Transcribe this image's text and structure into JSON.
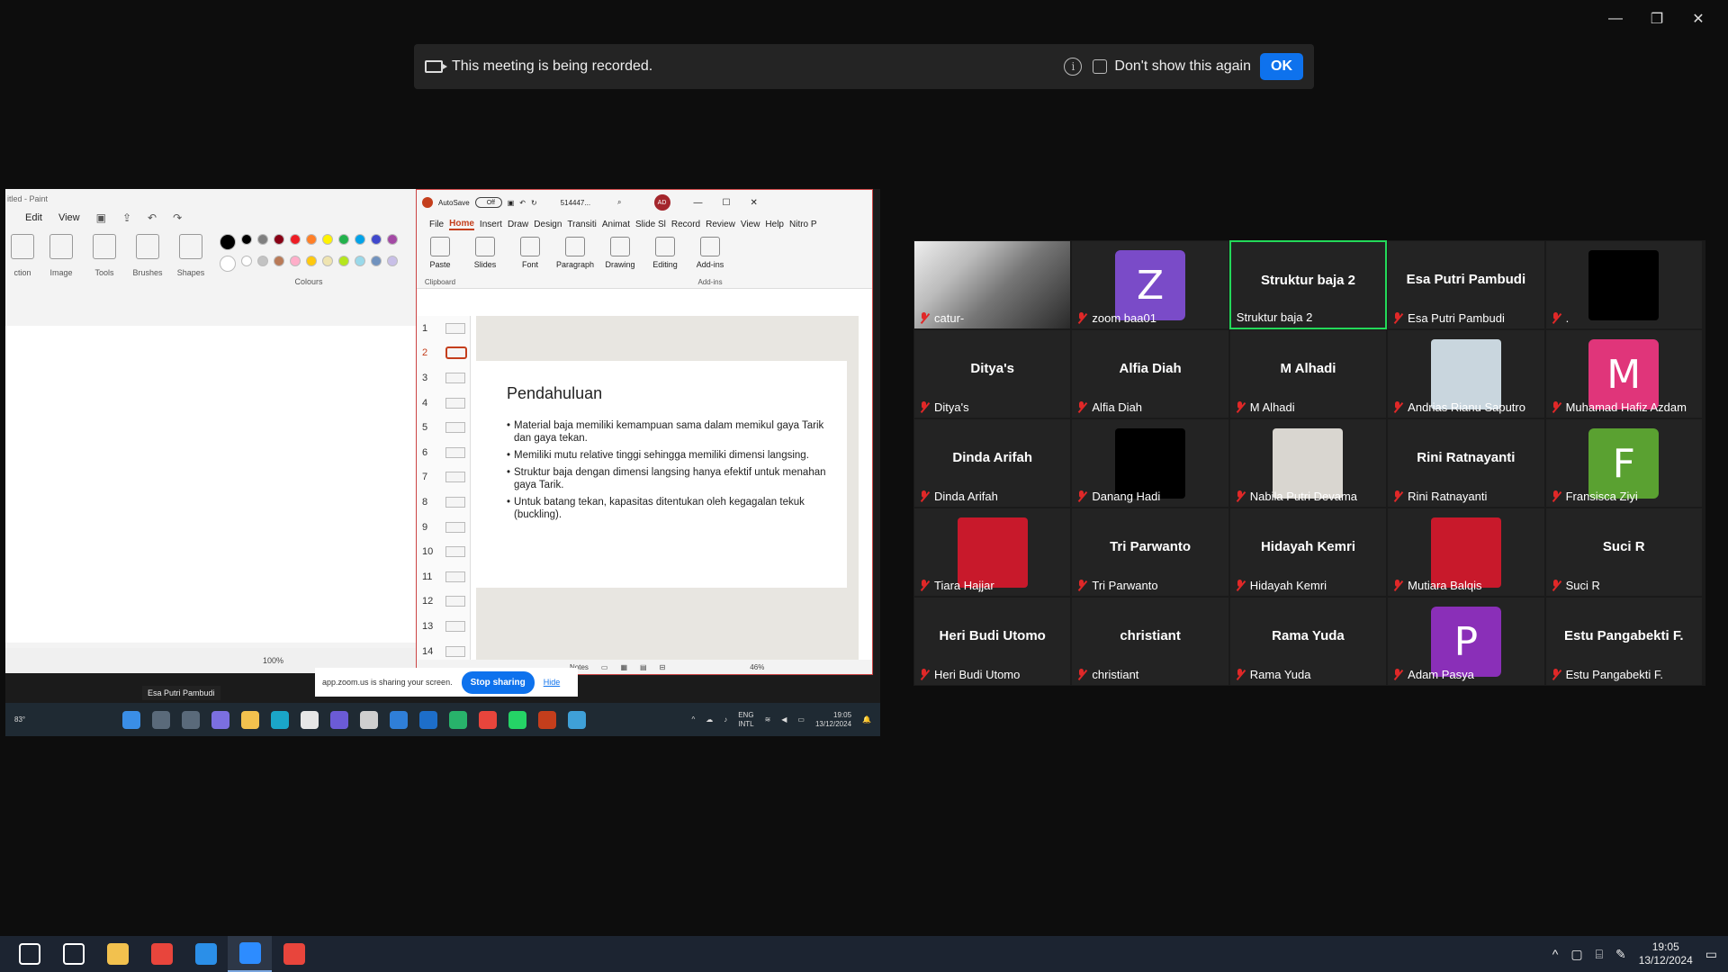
{
  "window_controls": [
    "—",
    "❐",
    "✕"
  ],
  "recording_banner": {
    "message": "This meeting is being recorded.",
    "dont_show": "Don't show this again",
    "ok": "OK"
  },
  "paint": {
    "title": "itled - Paint",
    "menu": [
      "Edit",
      "View"
    ],
    "tools": [
      "ction",
      "Image",
      "Tools",
      "Brushes",
      "Shapes"
    ],
    "colours_label": "Colours",
    "zoom": "100%"
  },
  "ppt": {
    "autosave": "AutoSave",
    "autosave_state": "Off",
    "filename": "514447...",
    "avatar": "AD",
    "tabs": [
      "File",
      "Home",
      "Insert",
      "Draw",
      "Design",
      "Transiti",
      "Animat",
      "Slide Sl",
      "Record",
      "Review",
      "View",
      "Help",
      "Nitro P"
    ],
    "ribbon": [
      {
        "label": "Paste"
      },
      {
        "label": "Slides"
      },
      {
        "label": "Font"
      },
      {
        "label": "Paragraph"
      },
      {
        "label": "Drawing"
      },
      {
        "label": "Editing"
      },
      {
        "label": "Add-ins"
      }
    ],
    "group_labels": [
      "Clipboard",
      "Add-ins"
    ],
    "thumbs": [
      "1",
      "2",
      "3",
      "4",
      "5",
      "6",
      "7",
      "8",
      "9",
      "10",
      "11",
      "12",
      "13",
      "14"
    ],
    "selected_slide": "2",
    "slide": {
      "title": "Pendahuluan",
      "bullets": [
        "Material baja memiliki kemampuan sama dalam memikul gaya Tarik dan gaya tekan.",
        "Memiliki mutu relative tinggi sehingga memiliki dimensi langsing.",
        "Struktur baja dengan dimensi langsing hanya efektif untuk menahan gaya Tarik.",
        "Untuk batang tekan, kapasitas ditentukan oleh kegagalan tekuk (buckling)."
      ]
    },
    "notes": "Notes",
    "zoom": "46%"
  },
  "share_bar": {
    "text": "app.zoom.us is sharing your screen.",
    "stop": "Stop sharing",
    "hide": "Hide"
  },
  "speaker_tag": "Esa Putri Pambudi",
  "inner_taskbar": {
    "weather": "83°",
    "lang1": "ENG",
    "lang2": "INTL",
    "time": "19:05",
    "date": "13/12/2024"
  },
  "gallery": [
    {
      "label": "catur-",
      "type": "fullphoto"
    },
    {
      "label": "zoom baa01",
      "type": "avatar",
      "letter": "Z",
      "color": "#7a4bc8"
    },
    {
      "label": "Struktur baja 2",
      "type": "name",
      "big": "Struktur baja 2",
      "active": true,
      "nomic": true
    },
    {
      "label": "Esa Putri Pambudi",
      "type": "name",
      "big": "Esa Putri Pambudi"
    },
    {
      "label": ".",
      "type": "photo",
      "color": "#000000"
    },
    {
      "label": "Ditya's",
      "type": "name",
      "big": "Ditya's"
    },
    {
      "label": "Alfia Diah",
      "type": "name",
      "big": "Alfia Diah"
    },
    {
      "label": "M Alhadi",
      "type": "name",
      "big": "M Alhadi"
    },
    {
      "label": "Andrias Rianu Saputro",
      "type": "photo",
      "color": "#c9d6de"
    },
    {
      "label": "Muhamad Hafiz Azdam",
      "type": "avatar",
      "letter": "M",
      "color": "#e0357a"
    },
    {
      "label": "Dinda Arifah",
      "type": "name",
      "big": "Dinda Arifah"
    },
    {
      "label": "Danang Hadi",
      "type": "photo",
      "color": "#000000"
    },
    {
      "label": "Nabila Putri Devama",
      "type": "photo",
      "color": "#d9d6d0"
    },
    {
      "label": "Rini Ratnayanti",
      "type": "name",
      "big": "Rini Ratnayanti"
    },
    {
      "label": "Fransisca Ziyi",
      "type": "avatar",
      "letter": "F",
      "color": "#5aa131"
    },
    {
      "label": "Tiara Hajjar",
      "type": "photo",
      "color": "#c8192b"
    },
    {
      "label": "Tri Parwanto",
      "type": "name",
      "big": "Tri Parwanto"
    },
    {
      "label": "Hidayah Kemri",
      "type": "name",
      "big": "Hidayah Kemri"
    },
    {
      "label": "Mutiara Balqis",
      "type": "photo",
      "color": "#c8192b"
    },
    {
      "label": "Suci R",
      "type": "name",
      "big": "Suci R"
    },
    {
      "label": "Heri Budi Utomo",
      "type": "name",
      "big": "Heri Budi Utomo"
    },
    {
      "label": "christiant",
      "type": "name",
      "big": "christiant"
    },
    {
      "label": "Rama Yuda",
      "type": "name",
      "big": "Rama Yuda"
    },
    {
      "label": "Adam Pasya",
      "type": "avatar",
      "letter": "P",
      "color": "#8a2fb8"
    },
    {
      "label": "Estu Pangabekti F.",
      "type": "name",
      "big": "Estu Pangabekti F."
    }
  ],
  "taskbar": {
    "apps": [
      {
        "name": "start-icon",
        "color": "#ffffff"
      },
      {
        "name": "search-icon",
        "color": "#ffffff"
      },
      {
        "name": "file-explorer-icon",
        "color": "#f2c14e"
      },
      {
        "name": "chrome-icon",
        "color": "#e8453c"
      },
      {
        "name": "azure-data-studio-icon",
        "color": "#2b8fe8"
      },
      {
        "name": "zoom-icon",
        "color": "#2d8cff",
        "active": true
      },
      {
        "name": "chrome-profile-icon",
        "color": "#e8453c"
      }
    ],
    "time": "19:05",
    "date": "13/12/2024"
  }
}
